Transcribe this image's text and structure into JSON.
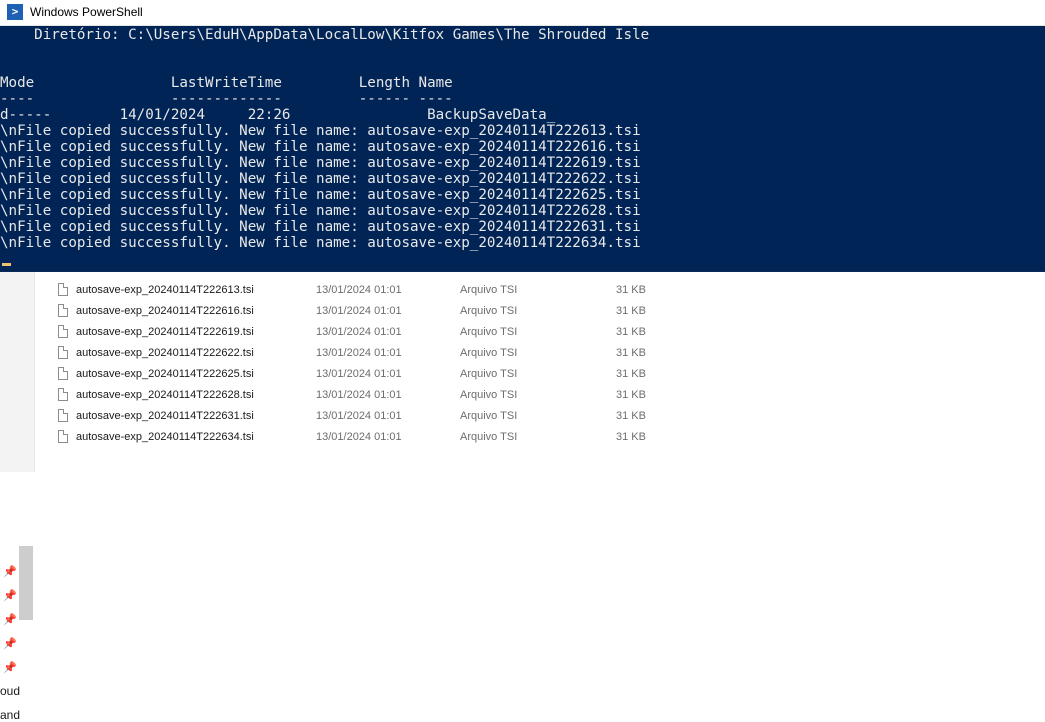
{
  "window": {
    "title": "Windows PowerShell"
  },
  "console": {
    "directory_line": "    Diretório: C:\\Users\\EduH\\AppData\\LocalLow\\Kitfox Games\\The Shrouded Isle",
    "header_line": "Mode                LastWriteTime         Length Name",
    "underline_line": "----                -------------         ------ ----",
    "dir_entry_line": "d-----        14/01/2024     22:26                BackupSaveData_",
    "copy_lines": [
      "\\nFile copied successfully. New file name: autosave-exp_20240114T222613.tsi",
      "\\nFile copied successfully. New file name: autosave-exp_20240114T222616.tsi",
      "\\nFile copied successfully. New file name: autosave-exp_20240114T222619.tsi",
      "\\nFile copied successfully. New file name: autosave-exp_20240114T222622.tsi",
      "\\nFile copied successfully. New file name: autosave-exp_20240114T222625.tsi",
      "\\nFile copied successfully. New file name: autosave-exp_20240114T222628.tsi",
      "\\nFile copied successfully. New file name: autosave-exp_20240114T222631.tsi",
      "\\nFile copied successfully. New file name: autosave-exp_20240114T222634.tsi"
    ]
  },
  "explorer": {
    "nav_labels": [
      "oud",
      "and"
    ],
    "files": [
      {
        "name": "autosave-exp_20240114T222613.tsi",
        "date": "13/01/2024 01:01",
        "type": "Arquivo TSI",
        "size": "31 KB"
      },
      {
        "name": "autosave-exp_20240114T222616.tsi",
        "date": "13/01/2024 01:01",
        "type": "Arquivo TSI",
        "size": "31 KB"
      },
      {
        "name": "autosave-exp_20240114T222619.tsi",
        "date": "13/01/2024 01:01",
        "type": "Arquivo TSI",
        "size": "31 KB"
      },
      {
        "name": "autosave-exp_20240114T222622.tsi",
        "date": "13/01/2024 01:01",
        "type": "Arquivo TSI",
        "size": "31 KB"
      },
      {
        "name": "autosave-exp_20240114T222625.tsi",
        "date": "13/01/2024 01:01",
        "type": "Arquivo TSI",
        "size": "31 KB"
      },
      {
        "name": "autosave-exp_20240114T222628.tsi",
        "date": "13/01/2024 01:01",
        "type": "Arquivo TSI",
        "size": "31 KB"
      },
      {
        "name": "autosave-exp_20240114T222631.tsi",
        "date": "13/01/2024 01:01",
        "type": "Arquivo TSI",
        "size": "31 KB"
      },
      {
        "name": "autosave-exp_20240114T222634.tsi",
        "date": "13/01/2024 01:01",
        "type": "Arquivo TSI",
        "size": "31 KB"
      }
    ]
  },
  "colors": {
    "console_background": "#012456",
    "console_text": "#e8e8e8"
  },
  "icons": {
    "app_icon": "powershell-icon",
    "pin_icon": "pin-icon",
    "file_icon": "file-icon"
  }
}
